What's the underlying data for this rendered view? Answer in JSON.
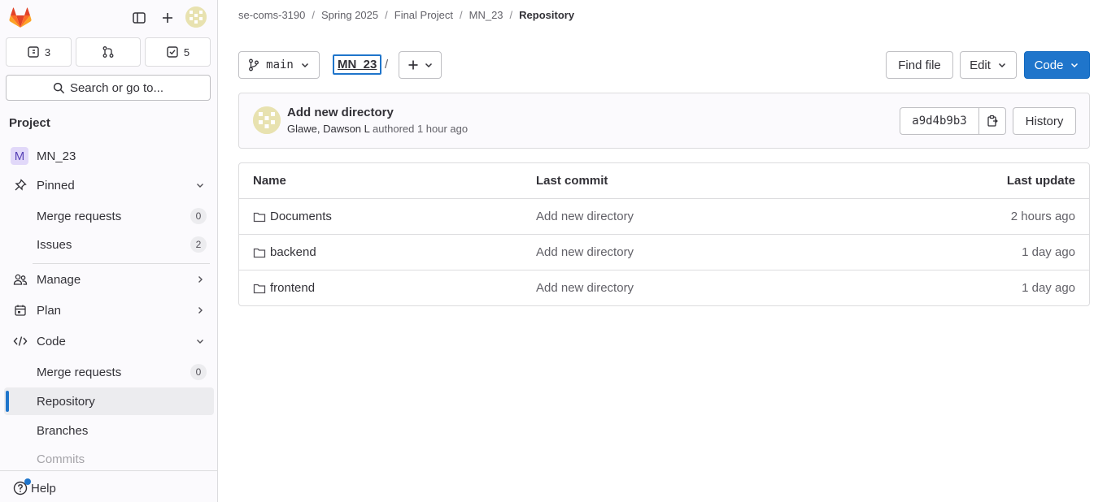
{
  "sidebar": {
    "counters": {
      "issues": "3",
      "todos": "5"
    },
    "search_label": "Search or go to...",
    "section_title": "Project",
    "project_initial": "M",
    "project_name": "MN_23",
    "items": [
      {
        "label": "Pinned"
      },
      {
        "label": "Merge requests",
        "badge": "0"
      },
      {
        "label": "Issues",
        "badge": "2"
      },
      {
        "label": "Manage"
      },
      {
        "label": "Plan"
      },
      {
        "label": "Code"
      },
      {
        "label": "Merge requests",
        "badge": "0"
      },
      {
        "label": "Repository"
      },
      {
        "label": "Branches"
      },
      {
        "label": "Commits"
      }
    ],
    "help_label": "Help"
  },
  "breadcrumb": [
    "se-coms-3190",
    "Spring 2025",
    "Final Project",
    "MN_23",
    "Repository"
  ],
  "toolbar": {
    "branch": "main",
    "path_root": "MN_23",
    "path_sep": "/",
    "find_file": "Find file",
    "edit": "Edit",
    "code": "Code"
  },
  "commit": {
    "title": "Add new directory",
    "author": "Glawe, Dawson L",
    "authored_text": "authored 1 hour ago",
    "sha": "a9d4b9b3",
    "history": "History"
  },
  "table": {
    "headers": {
      "name": "Name",
      "last_commit": "Last commit",
      "last_update": "Last update"
    },
    "rows": [
      {
        "name": "Documents",
        "commit": "Add new directory",
        "updated": "2 hours ago"
      },
      {
        "name": "backend",
        "commit": "Add new directory",
        "updated": "1 day ago"
      },
      {
        "name": "frontend",
        "commit": "Add new directory",
        "updated": "1 day ago"
      }
    ]
  },
  "colors": {
    "accent": "#1f75cb",
    "brand_orange": "#fc6d26"
  }
}
